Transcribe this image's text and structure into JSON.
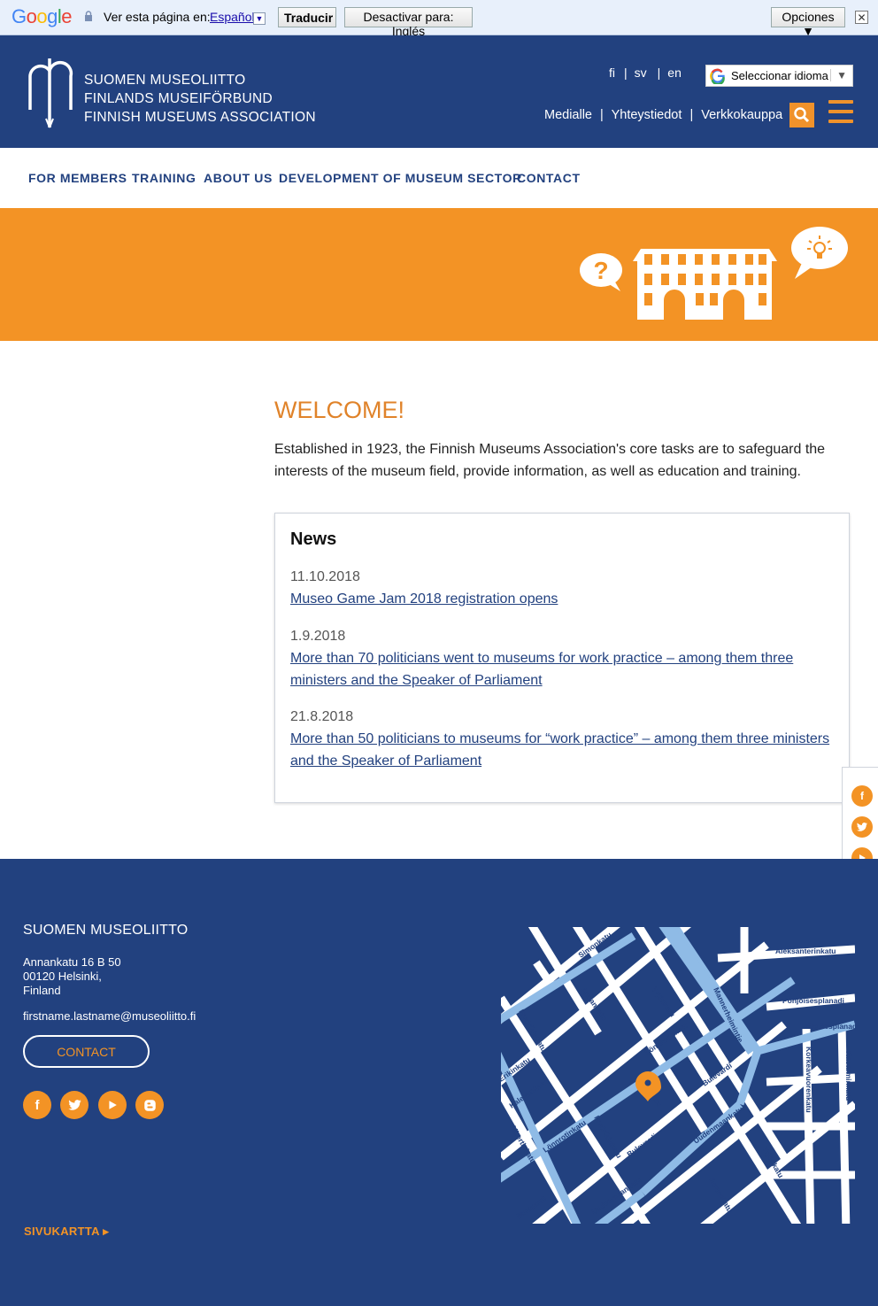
{
  "translate_bar": {
    "logo": "Google",
    "prompt": "Ver esta página en:",
    "language": "Español",
    "translate_button": "Traducir",
    "disable_button": "Desactivar para: Inglés",
    "options_button": "Opciones ▼",
    "close": "✕"
  },
  "header": {
    "logo_lines": [
      "SUOMEN MUSEOLIITTO",
      "FINLANDS MUSEIFÖRBUND",
      "FINNISH MUSEUMS ASSOCIATION"
    ],
    "languages": [
      "fi",
      "sv",
      "en"
    ],
    "language_selector": "Seleccionar idioma",
    "utility_links": [
      "Medialle",
      "Yhteystiedot",
      "Verkkokauppa"
    ],
    "search_icon": "search-icon",
    "menu_icon": "hamburger-menu-icon",
    "accent_color": "#f39325",
    "brand_color": "#22417f"
  },
  "nav": {
    "items": [
      "FOR MEMBERS",
      "TRAINING",
      "ABOUT US",
      "DEVELOPMENT OF MUSEUM SECTOR",
      "CONTACT"
    ]
  },
  "banner": {
    "icons": [
      "question-bubble-icon",
      "museum-building-icon",
      "lightbulb-bubble-icon"
    ]
  },
  "main": {
    "heading": "WELCOME!",
    "intro": "Established in 1923, the Finnish Museums Association's core tasks are to safeguard the interests of the museum field, provide information, as well as education and training."
  },
  "news": {
    "title": "News",
    "items": [
      {
        "date": "11.10.2018",
        "title": "Museo Game Jam 2018 registration opens"
      },
      {
        "date": "1.9.2018",
        "title": "More than 70 politicians went to museums for work practice – among them three ministers and the Speaker of Parliament"
      },
      {
        "date": "21.8.2018",
        "title": "More than 50 politicians to museums for “work practice” – among them three ministers and the Speaker of Parliament"
      }
    ]
  },
  "side_social": [
    "facebook-icon",
    "twitter-icon",
    "youtube-icon",
    "blogger-icon"
  ],
  "footer": {
    "title": "SUOMEN MUSEOLIITTO",
    "address": [
      "Annankatu 16 B 50",
      "00120 Helsinki,",
      "Finland"
    ],
    "email": "firstname.lastname@museoliitto.fi",
    "contact_button": "CONTACT",
    "social": [
      "facebook-icon",
      "twitter-icon",
      "youtube-icon",
      "blogger-icon"
    ],
    "sitemap": "SIVUKARTTA ▸"
  },
  "map": {
    "streets": [
      "Aleksanterinkatu",
      "Pohjoisesplanadi",
      "Eteläesplanadi",
      "Simonkatu",
      "Annankatu",
      "Yrjönkatu",
      "Mannerheimintie",
      "Fredrikinkatu",
      "Lönnrotinkatu",
      "Kalevankatu",
      "Albertinkatu",
      "Bulevardi",
      "Uudenmaankatu",
      "Korkeavuorenkatu",
      "Kasarminkatu"
    ]
  }
}
